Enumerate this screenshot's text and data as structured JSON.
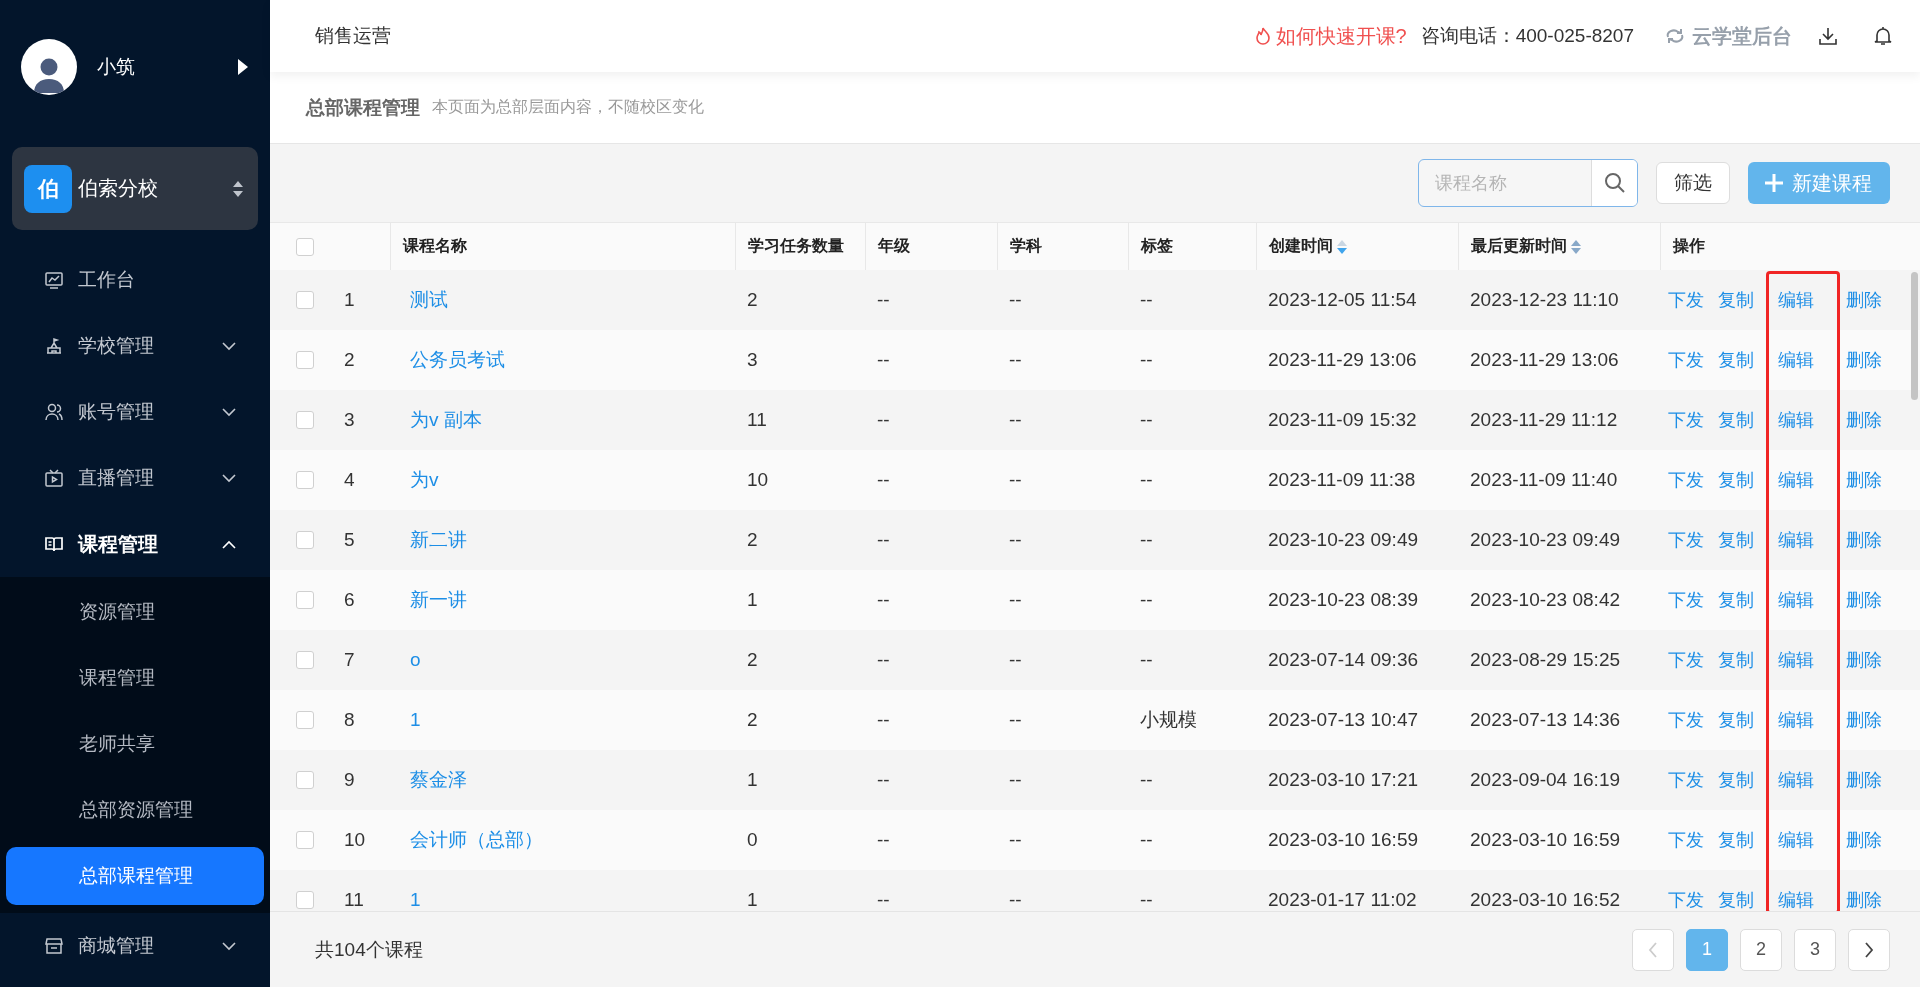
{
  "sidebar": {
    "user": {
      "name": "小筑"
    },
    "school": {
      "badge": "伯",
      "name": "伯索分校"
    },
    "menu": [
      {
        "label": "工作台"
      },
      {
        "label": "学校管理",
        "expanded": false
      },
      {
        "label": "账号管理",
        "expanded": false
      },
      {
        "label": "直播管理",
        "expanded": false
      },
      {
        "label": "课程管理",
        "expanded": true,
        "children": [
          {
            "label": "资源管理",
            "selected": false
          },
          {
            "label": "课程管理",
            "selected": false
          },
          {
            "label": "老师共享",
            "selected": false
          },
          {
            "label": "总部资源管理",
            "selected": false
          },
          {
            "label": "总部课程管理",
            "selected": true
          }
        ]
      },
      {
        "label": "商城管理",
        "expanded": false
      }
    ]
  },
  "topbar": {
    "title": "销售运营",
    "help_link": "如何快速开课?",
    "hotline": "咨询电话：400-025-8207",
    "backend_link": "云学堂后台"
  },
  "page_header": {
    "title": "总部课程管理",
    "note": "本页面为总部层面内容，不随校区变化"
  },
  "toolbar": {
    "search": {
      "placeholder": "课程名称"
    },
    "filter_button": "筛选",
    "create_button": "新建课程"
  },
  "table": {
    "select_all": {
      "checked": false
    },
    "columns": [
      {
        "label": "课程名称"
      },
      {
        "label": "学习任务数量"
      },
      {
        "label": "年级"
      },
      {
        "label": "学科"
      },
      {
        "label": "标签"
      },
      {
        "label": "创建时间",
        "sorted_desc": true
      },
      {
        "label": "最后更新时间",
        "sorted_desc": false
      },
      {
        "label": "操作"
      }
    ],
    "rows": [
      {
        "checked": false,
        "index": "1",
        "name": "测试",
        "tasks": "2",
        "grade": "--",
        "subject": "--",
        "tag": "--",
        "created": "2023-12-05 11:54",
        "updated": "2023-12-23 11:10",
        "actions": [
          "下发",
          "复制",
          "编辑",
          "删除"
        ]
      },
      {
        "checked": false,
        "index": "2",
        "name": "公务员考试",
        "tasks": "3",
        "grade": "--",
        "subject": "--",
        "tag": "--",
        "created": "2023-11-29 13:06",
        "updated": "2023-11-29 13:06",
        "actions": [
          "下发",
          "复制",
          "编辑",
          "删除"
        ]
      },
      {
        "checked": false,
        "index": "3",
        "name": "为v 副本",
        "tasks": "11",
        "grade": "--",
        "subject": "--",
        "tag": "--",
        "created": "2023-11-09 15:32",
        "updated": "2023-11-29 11:12",
        "actions": [
          "下发",
          "复制",
          "编辑",
          "删除"
        ]
      },
      {
        "checked": false,
        "index": "4",
        "name": "为v",
        "tasks": "10",
        "grade": "--",
        "subject": "--",
        "tag": "--",
        "created": "2023-11-09 11:38",
        "updated": "2023-11-09 11:40",
        "actions": [
          "下发",
          "复制",
          "编辑",
          "删除"
        ]
      },
      {
        "checked": false,
        "index": "5",
        "name": "新二讲",
        "tasks": "2",
        "grade": "--",
        "subject": "--",
        "tag": "--",
        "created": "2023-10-23 09:49",
        "updated": "2023-10-23 09:49",
        "actions": [
          "下发",
          "复制",
          "编辑",
          "删除"
        ]
      },
      {
        "checked": false,
        "index": "6",
        "name": "新一讲",
        "tasks": "1",
        "grade": "--",
        "subject": "--",
        "tag": "--",
        "created": "2023-10-23 08:39",
        "updated": "2023-10-23 08:42",
        "actions": [
          "下发",
          "复制",
          "编辑",
          "删除"
        ]
      },
      {
        "checked": false,
        "index": "7",
        "name": "o",
        "tasks": "2",
        "grade": "--",
        "subject": "--",
        "tag": "--",
        "created": "2023-07-14 09:36",
        "updated": "2023-08-29 15:25",
        "actions": [
          "下发",
          "复制",
          "编辑",
          "删除"
        ]
      },
      {
        "checked": false,
        "index": "8",
        "name": "1",
        "tasks": "2",
        "grade": "--",
        "subject": "--",
        "tag": "小规模",
        "created": "2023-07-13 10:47",
        "updated": "2023-07-13 14:36",
        "actions": [
          "下发",
          "复制",
          "编辑",
          "删除"
        ]
      },
      {
        "checked": false,
        "index": "9",
        "name": "蔡金泽",
        "tasks": "1",
        "grade": "--",
        "subject": "--",
        "tag": "--",
        "created": "2023-03-10 17:21",
        "updated": "2023-09-04 16:19",
        "actions": [
          "下发",
          "复制",
          "编辑",
          "删除"
        ]
      },
      {
        "checked": false,
        "index": "10",
        "name": "会计师（总部）",
        "tasks": "0",
        "grade": "--",
        "subject": "--",
        "tag": "--",
        "created": "2023-03-10 16:59",
        "updated": "2023-03-10 16:59",
        "actions": [
          "下发",
          "复制",
          "编辑",
          "删除"
        ]
      },
      {
        "checked": false,
        "index": "11",
        "name": "1",
        "tasks": "1",
        "grade": "--",
        "subject": "--",
        "tag": "--",
        "created": "2023-01-17 11:02",
        "updated": "2023-03-10 16:52",
        "actions": [
          "下发",
          "复制",
          "编辑",
          "删除"
        ]
      }
    ]
  },
  "footer": {
    "total": "共104个课程",
    "pagination": {
      "prev": {
        "disabled": true
      },
      "pages": [
        {
          "label": "1",
          "selected": true
        },
        {
          "label": "2",
          "selected": false
        },
        {
          "label": "3",
          "selected": false
        }
      ],
      "next": {
        "disabled": false
      }
    }
  }
}
